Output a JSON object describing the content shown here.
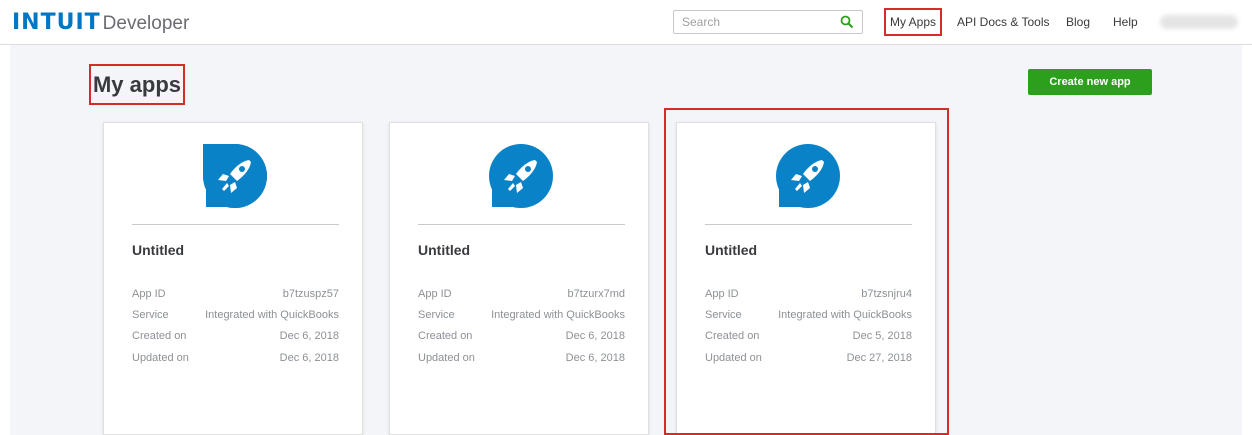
{
  "header": {
    "logo_brand": "INTUIT",
    "logo_product": "Developer",
    "search": {
      "placeholder": "Search",
      "value": ""
    },
    "nav": {
      "my_apps": "My Apps",
      "api_docs": "API Docs & Tools",
      "blog": "Blog",
      "help": "Help"
    }
  },
  "page": {
    "title": "My apps",
    "create_button": "Create new app"
  },
  "apps": [
    {
      "title": "Untitled",
      "fields": [
        {
          "label": "App ID",
          "value": "b7tzuspz57"
        },
        {
          "label": "Service",
          "value": "Integrated with QuickBooks"
        },
        {
          "label": "Created on",
          "value": "Dec 6, 2018"
        },
        {
          "label": "Updated on",
          "value": "Dec 6, 2018"
        }
      ]
    },
    {
      "title": "Untitled",
      "fields": [
        {
          "label": "App ID",
          "value": "b7tzurx7md"
        },
        {
          "label": "Service",
          "value": "Integrated with QuickBooks"
        },
        {
          "label": "Created on",
          "value": "Dec 6, 2018"
        },
        {
          "label": "Updated on",
          "value": "Dec 6, 2018"
        }
      ]
    },
    {
      "title": "Untitled",
      "fields": [
        {
          "label": "App ID",
          "value": "b7tzsnjru4"
        },
        {
          "label": "Service",
          "value": "Integrated with QuickBooks"
        },
        {
          "label": "Created on",
          "value": "Dec 5, 2018"
        },
        {
          "label": "Updated on",
          "value": "Dec 27, 2018"
        }
      ]
    }
  ],
  "colors": {
    "brand_blue": "#0077c5",
    "create_green": "#2ca01c",
    "highlight_red": "#d52b2b",
    "background": "#f4f5f8"
  },
  "icons": {
    "search": "search-icon",
    "app": "rocket-icon"
  }
}
